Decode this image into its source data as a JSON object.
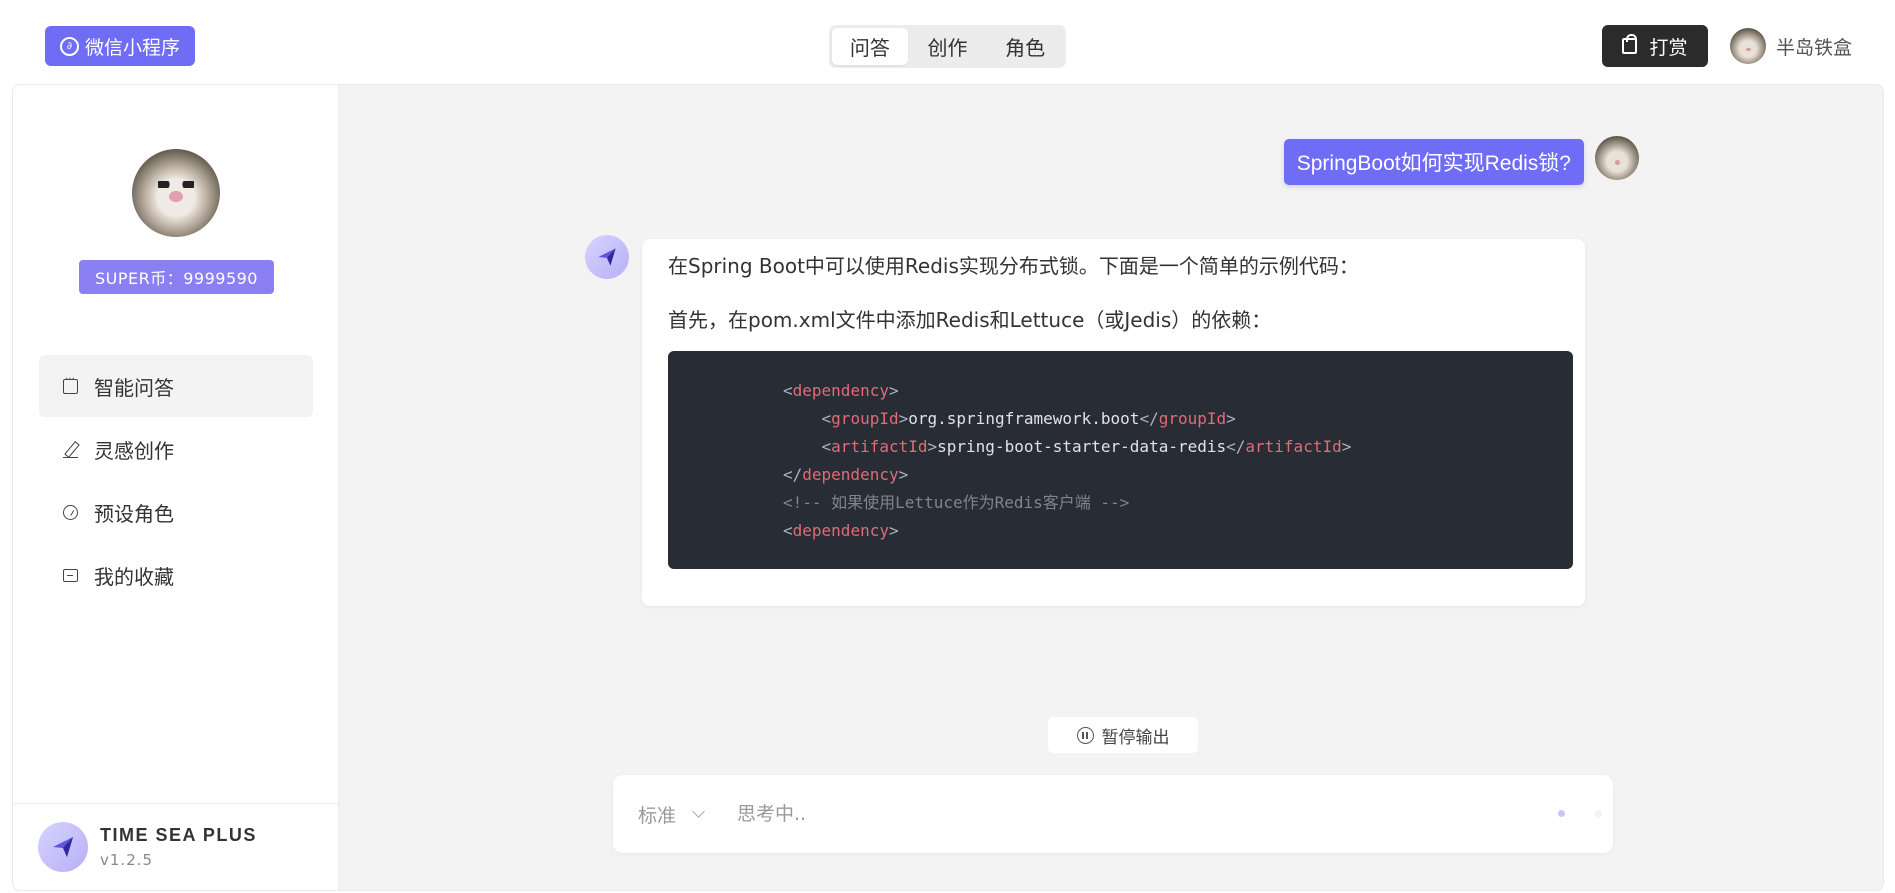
{
  "header": {
    "mini_program_label": "微信小程序",
    "tabs": [
      {
        "label": "问答",
        "active": true
      },
      {
        "label": "创作",
        "active": false
      },
      {
        "label": "角色",
        "active": false
      }
    ],
    "tip_label": "打赏",
    "user_name": "半岛铁盒"
  },
  "sidebar": {
    "coins": "SUPER币：9999590",
    "items": [
      {
        "label": "智能问答",
        "icon": "chat-icon",
        "active": true
      },
      {
        "label": "灵感创作",
        "icon": "pen-icon",
        "active": false
      },
      {
        "label": "预设角色",
        "icon": "role-icon",
        "active": false
      },
      {
        "label": "我的收藏",
        "icon": "favorites-icon",
        "active": false
      }
    ],
    "brand": "TIME SEA PLUS",
    "version": "v1.2.5"
  },
  "chat": {
    "question": "SpringBoot如何实现Redis锁?",
    "answer_p1": "在Spring Boot中可以使用Redis实现分布式锁。下面是一个简单的示例代码：",
    "answer_p2": "首先，在pom.xml文件中添加Redis和Lettuce（或Jedis）的依赖：",
    "code": {
      "l1_tag": "dependency",
      "l2_tag": "groupId",
      "l2_text": "org.springframework.boot",
      "l3_tag": "artifactId",
      "l3_text": "spring-boot-starter-data-redis",
      "l4_tag": "dependency",
      "l5_comment": "<!-- 如果使用Lettuce作为Redis客户端 -->",
      "l6_tag": "dependency"
    },
    "pause_label": "暂停输出",
    "mode_label": "标准",
    "input_placeholder": "思考中.."
  },
  "colors": {
    "accent": "#6f6cf6",
    "coin_badge": "#8a7ff3",
    "code_bg": "#282c34",
    "code_tag": "#e06c75",
    "tip_button": "#2b2b2b"
  }
}
